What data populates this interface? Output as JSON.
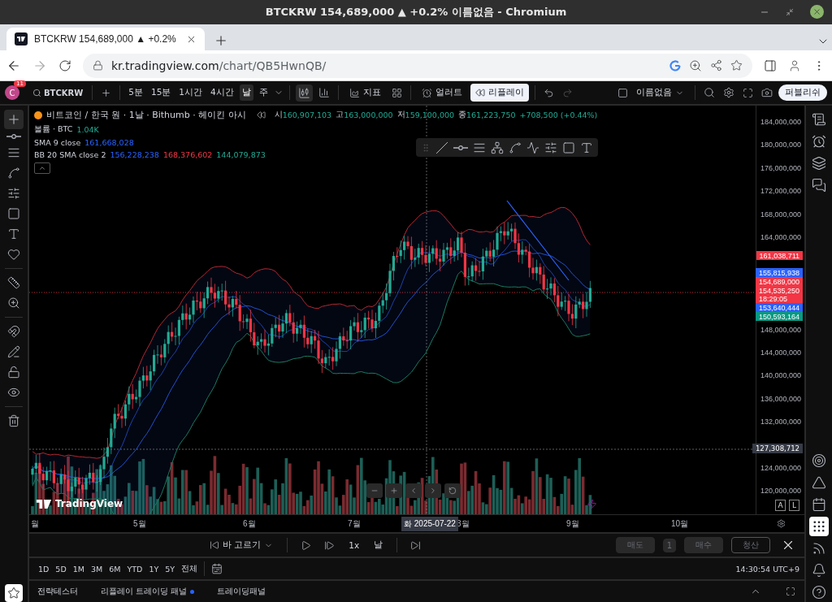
{
  "window": {
    "title": "BTCKRW 154,689,000 ▲ +0.2% 이름없음 - Chromium"
  },
  "browser": {
    "tab_title": "BTCKRW 154,689,000 ▲ +0.2%",
    "url_host": "kr.tradingview.com",
    "url_path": "/chart/QB5HwnQB/"
  },
  "toolbar": {
    "avatar_letter": "C",
    "avatar_badge": "11",
    "symbol": "BTCKRW",
    "intervals": [
      {
        "label": "5분",
        "selected": false
      },
      {
        "label": "15분",
        "selected": false
      },
      {
        "label": "1시간",
        "selected": false
      },
      {
        "label": "4시간",
        "selected": false
      },
      {
        "label": "날",
        "selected": true
      },
      {
        "label": "주",
        "selected": false
      }
    ],
    "indicators": "지표",
    "alert": "얼러트",
    "replay": {
      "label": "리플레이",
      "active": true
    },
    "layout_name": "이름없음",
    "publish": "퍼블리쉬"
  },
  "legend": {
    "title": "비트코인 / 한국 원 · 1날 · Bithumb · 헤이킨 아시",
    "ohlc": [
      {
        "label": "시",
        "value": "160,907,103"
      },
      {
        "label": "고",
        "value": "163,000,000"
      },
      {
        "label": "저",
        "value": "159,100,000"
      },
      {
        "label": "종",
        "value": "161,223,750"
      }
    ],
    "change": "+708,500 (+0.44%)",
    "volume": {
      "label": "볼륨 · BTC",
      "value": "1.04K"
    },
    "sma": {
      "label": "SMA 9 close",
      "values": [
        {
          "text": "161,668,028",
          "color": "#2962ff"
        }
      ]
    },
    "bb": {
      "label": "BB 20 SMA close 2",
      "values": [
        {
          "text": "156,228,238",
          "color": "#2962ff"
        },
        {
          "text": "168,376,602",
          "color": "#f23645"
        },
        {
          "text": "144,079,873",
          "color": "#22ab94"
        }
      ]
    }
  },
  "price_axis": {
    "ticks": [
      "184,000,000",
      "180,000,000",
      "176,000,000",
      "172,000,000",
      "168,000,000",
      "164,000,000",
      "148,000,000",
      "144,000,000",
      "140,000,000",
      "136,000,000",
      "132,000,000",
      "124,000,000",
      "120,000,000"
    ],
    "top_label": {
      "text": "161,038,711",
      "color": "#f23645"
    },
    "labels": [
      {
        "text": "155,815,938",
        "color": "#2962ff"
      },
      {
        "text": "154,689,000",
        "color": "#f23645"
      },
      {
        "text": "154,535,250",
        "time": "18:29:05",
        "color": "#f23645"
      },
      {
        "text": "153,640,444",
        "color": "#2962ff"
      },
      {
        "text": "150,593,164",
        "color": "#089981"
      }
    ],
    "crosshair_price": "127,308,712"
  },
  "time_axis": {
    "labels": [
      "월",
      "5월",
      "6월",
      "7월",
      "8월",
      "9월",
      "10월"
    ],
    "crosshair_date": "화 2025-07-22"
  },
  "chart_logo": "TradingView",
  "scale_buttons": [
    "A",
    "L"
  ],
  "replay_bar": {
    "select_bar": "바 고르기",
    "speed": "1x",
    "interval": "날",
    "trade_buttons": [
      {
        "label": "매도",
        "kind": "filled"
      },
      {
        "label": "1",
        "kind": "filled"
      },
      {
        "label": "매수",
        "kind": "filled"
      },
      {
        "label": "청산",
        "kind": "outline"
      }
    ]
  },
  "range_bar": {
    "ranges": [
      "1D",
      "5D",
      "1M",
      "3M",
      "6M",
      "YTD",
      "1Y",
      "5Y",
      "전체"
    ],
    "clock": "14:30:54 UTC+9"
  },
  "bottom_tabs": [
    {
      "label": "전략테스터",
      "dot": false
    },
    {
      "label": "리플레이 트레이딩 패널",
      "dot": true
    },
    {
      "label": "트레이딩패널",
      "dot": false
    }
  ]
}
